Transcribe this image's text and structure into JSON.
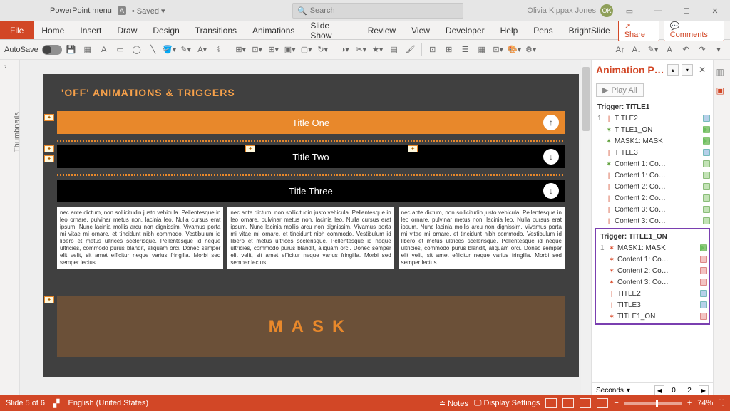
{
  "titlebar": {
    "doc_title": "PowerPoint menu",
    "accessibility_badge": "A",
    "saved_state": "Saved",
    "search_placeholder": "Search",
    "user_name": "Olivia Kippax Jones",
    "user_initials": "OK"
  },
  "ribbon": {
    "file": "File",
    "tabs": [
      "Home",
      "Insert",
      "Draw",
      "Design",
      "Transitions",
      "Animations",
      "Slide Show",
      "Review",
      "View",
      "Developer",
      "Help",
      "Pens",
      "BrightSlide"
    ],
    "share": "Share",
    "comments": "Comments"
  },
  "toolbar": {
    "autosave_label": "AutoSave"
  },
  "thumbnails": {
    "label": "Thumbnails"
  },
  "slide": {
    "header": "'OFF' ANIMATIONS & TRIGGERS",
    "title1": "Title One",
    "title2": "Title Two",
    "title3": "Title Three",
    "body": "nec ante dictum, non sollicitudin justo vehicula. Pellentesque in leo ornare, pulvinar metus non, lacinia leo. Nulla cursus erat ipsum. Nunc lacinia mollis arcu non dignissim. Vivamus porta mi vitae mi ornare, et tincidunt nibh commodo. Vestibulum id libero et metus ultrices scelerisque. Pellentesque id neque ultricies, commodo purus blandit, aliquam orci. Donec semper elit velit, sit amet efficitur neque varius fringilla. Morbi sed semper lectus.",
    "mask": "MASK"
  },
  "anim_pane": {
    "title": "Animation P…",
    "play_all": "Play All",
    "trigger1": "Trigger: TITLE1",
    "trigger2": "Trigger: TITLE1_ON",
    "list1": [
      {
        "num": "1",
        "ic": "bar",
        "label": "TITLE2",
        "chip": "blue"
      },
      {
        "num": "",
        "ic": "star-g",
        "label": "TITLE1_ON",
        "chip": "green"
      },
      {
        "num": "",
        "ic": "star-g",
        "label": "MASK1: MASK",
        "chip": "green"
      },
      {
        "num": "",
        "ic": "bar",
        "label": "TITLE3",
        "chip": "blue"
      },
      {
        "num": "",
        "ic": "star-g",
        "label": "Content 1: Co…",
        "chip": "g2"
      },
      {
        "num": "",
        "ic": "bar",
        "label": "Content 1: Co…",
        "chip": "g2"
      },
      {
        "num": "",
        "ic": "bar",
        "label": "Content 2: Co…",
        "chip": "g2"
      },
      {
        "num": "",
        "ic": "bar",
        "label": "Content 2: Co…",
        "chip": "g2"
      },
      {
        "num": "",
        "ic": "bar",
        "label": "Content 3: Co…",
        "chip": "g2"
      },
      {
        "num": "",
        "ic": "bar",
        "label": "Content 3: Co…",
        "chip": "g2"
      }
    ],
    "list2": [
      {
        "num": "1",
        "ic": "star-r",
        "label": "MASK1: MASK",
        "chip": "green"
      },
      {
        "num": "",
        "ic": "star-r",
        "label": "Content 1: Co…",
        "chip": "pink"
      },
      {
        "num": "",
        "ic": "star-r",
        "label": "Content 2: Co…",
        "chip": "pink"
      },
      {
        "num": "",
        "ic": "star-r",
        "label": "Content 3: Co…",
        "chip": "pink"
      },
      {
        "num": "",
        "ic": "bar",
        "label": "TITLE2",
        "chip": "blue"
      },
      {
        "num": "",
        "ic": "bar",
        "label": "TITLE3",
        "chip": "blue"
      },
      {
        "num": "",
        "ic": "star-r",
        "label": "TITLE1_ON",
        "chip": "pink2"
      }
    ],
    "seconds_label": "Seconds",
    "seconds_val0": "0",
    "seconds_val1": "2"
  },
  "status": {
    "slide_count": "Slide 5 of 6",
    "language": "English (United States)",
    "notes": "Notes",
    "display": "Display Settings",
    "zoom": "74%"
  }
}
